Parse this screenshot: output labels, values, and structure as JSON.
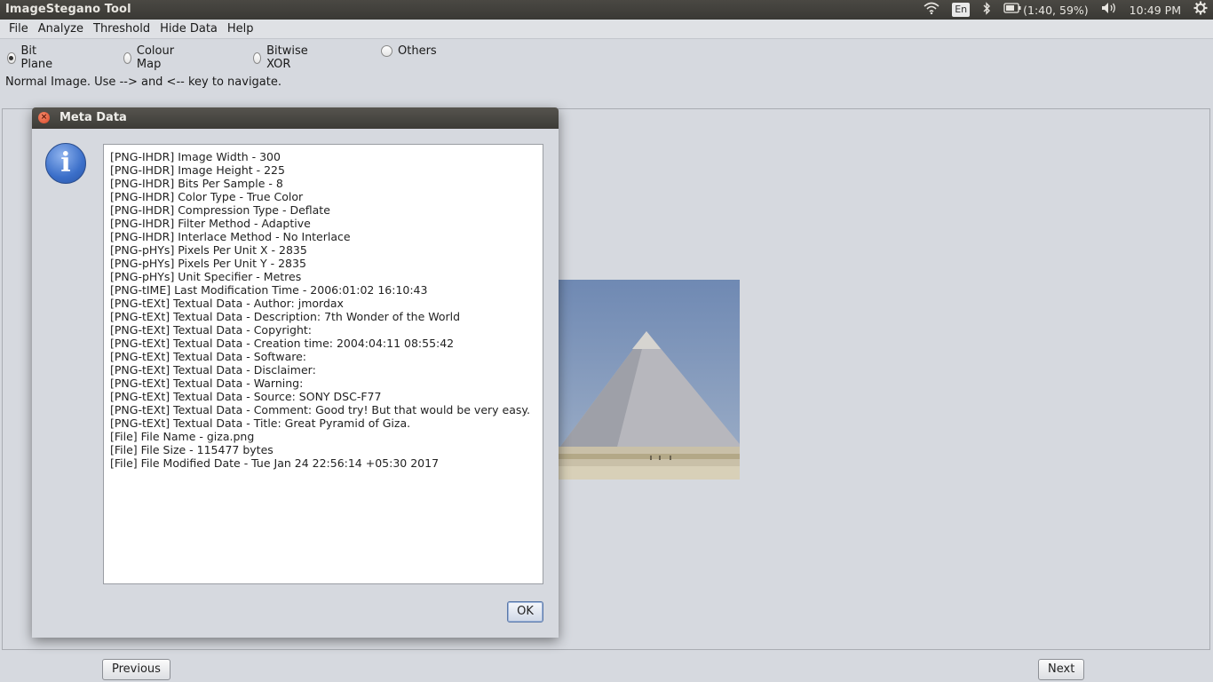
{
  "window": {
    "title": "ImageStegano Tool"
  },
  "tray": {
    "language": "En",
    "battery": "(1:40, 59%)",
    "time": "10:49 PM"
  },
  "menu": [
    "File",
    "Analyze",
    "Threshold",
    "Hide Data",
    "Help"
  ],
  "radios": [
    {
      "label": "Bit Plane",
      "selected": true
    },
    {
      "label": "Colour Map",
      "selected": false
    },
    {
      "label": "Bitwise XOR",
      "selected": false
    },
    {
      "label": "Others",
      "selected": false
    }
  ],
  "status_message": "Normal Image. Use --> and <-- key to navigate.",
  "navigation": {
    "previous": "Previous",
    "next": "Next"
  },
  "dialog": {
    "title": "Meta Data",
    "ok_label": "OK",
    "lines": [
      "[PNG-IHDR] Image Width - 300",
      "[PNG-IHDR] Image Height - 225",
      "[PNG-IHDR] Bits Per Sample - 8",
      "[PNG-IHDR] Color Type - True Color",
      "[PNG-IHDR] Compression Type - Deflate",
      "[PNG-IHDR] Filter Method - Adaptive",
      "[PNG-IHDR] Interlace Method - No Interlace",
      "[PNG-pHYs] Pixels Per Unit X - 2835",
      "[PNG-pHYs] Pixels Per Unit Y - 2835",
      "[PNG-pHYs] Unit Specifier - Metres",
      "[PNG-tIME] Last Modification Time - 2006:01:02 16:10:43",
      "[PNG-tEXt] Textual Data - Author: jmordax",
      "[PNG-tEXt] Textual Data - Description: 7th Wonder of the World",
      "[PNG-tEXt] Textual Data - Copyright:",
      "[PNG-tEXt] Textual Data - Creation time: 2004:04:11 08:55:42",
      "[PNG-tEXt] Textual Data - Software:",
      "[PNG-tEXt] Textual Data - Disclaimer:",
      "[PNG-tEXt] Textual Data - Warning:",
      "[PNG-tEXt] Textual Data - Source: SONY DSC-F77",
      "[PNG-tEXt] Textual Data - Comment: Good try! But that would be very easy.",
      "[PNG-tEXt] Textual Data - Title: Great Pyramid of Giza.",
      "[File] File Name - giza.png",
      "[File] File Size - 115477 bytes",
      "[File] File Modified Date - Tue Jan 24 22:56:14 +05:30 2017"
    ]
  },
  "icons": {
    "wifi": "wifi-icon",
    "bluetooth": "bluetooth-icon",
    "battery": "battery-icon",
    "volume": "volume-icon",
    "settings": "gear-icon",
    "info": "info-icon",
    "close": "close-icon"
  },
  "colors": {
    "panel_bg": "#3c3b37",
    "window_bg": "#d6d9df",
    "close_button": "#d9482a",
    "info_icon": "#3b6fc9"
  }
}
